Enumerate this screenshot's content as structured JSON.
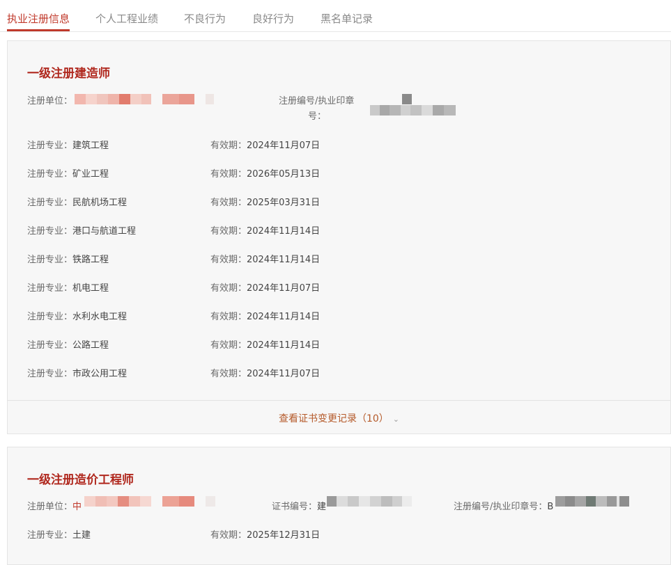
{
  "tabs": [
    {
      "label": "执业注册信息",
      "active": true
    },
    {
      "label": "个人工程业绩",
      "active": false
    },
    {
      "label": "不良行为",
      "active": false
    },
    {
      "label": "良好行为",
      "active": false
    },
    {
      "label": "黑名单记录",
      "active": false
    }
  ],
  "accent_color": "#c0392b",
  "card1": {
    "title": "一级注册建造师",
    "unit_label": "注册单位：",
    "reg_no_label_line1": "注册编号/执业印章",
    "reg_no_label_line2": "号：",
    "specialties": [
      {
        "label": "注册专业：",
        "value": "建筑工程",
        "validity_label": "有效期：",
        "validity": "2024年11月07日"
      },
      {
        "label": "注册专业：",
        "value": "矿业工程",
        "validity_label": "有效期：",
        "validity": "2026年05月13日"
      },
      {
        "label": "注册专业：",
        "value": "民航机场工程",
        "validity_label": "有效期：",
        "validity": "2025年03月31日"
      },
      {
        "label": "注册专业：",
        "value": "港口与航道工程",
        "validity_label": "有效期：",
        "validity": "2024年11月14日"
      },
      {
        "label": "注册专业：",
        "value": "铁路工程",
        "validity_label": "有效期：",
        "validity": "2024年11月14日"
      },
      {
        "label": "注册专业：",
        "value": "机电工程",
        "validity_label": "有效期：",
        "validity": "2024年11月07日"
      },
      {
        "label": "注册专业：",
        "value": "水利水电工程",
        "validity_label": "有效期：",
        "validity": "2024年11月14日"
      },
      {
        "label": "注册专业：",
        "value": "公路工程",
        "validity_label": "有效期：",
        "validity": "2024年11月14日"
      },
      {
        "label": "注册专业：",
        "value": "市政公用工程",
        "validity_label": "有效期：",
        "validity": "2024年11月07日"
      }
    ],
    "history_link": "查看证书变更记录（10）"
  },
  "card2": {
    "title": "一级注册造价工程师",
    "unit_label": "注册单位：",
    "unit_partial": "中",
    "cert_no_label": "证书编号：",
    "cert_no_partial": "建",
    "reg_no_label": "注册编号/执业印章号：",
    "reg_no_partial": "B",
    "specialty_label": "注册专业：",
    "specialty_value": "土建",
    "validity_label": "有效期：",
    "validity": "2025年12月31日"
  }
}
